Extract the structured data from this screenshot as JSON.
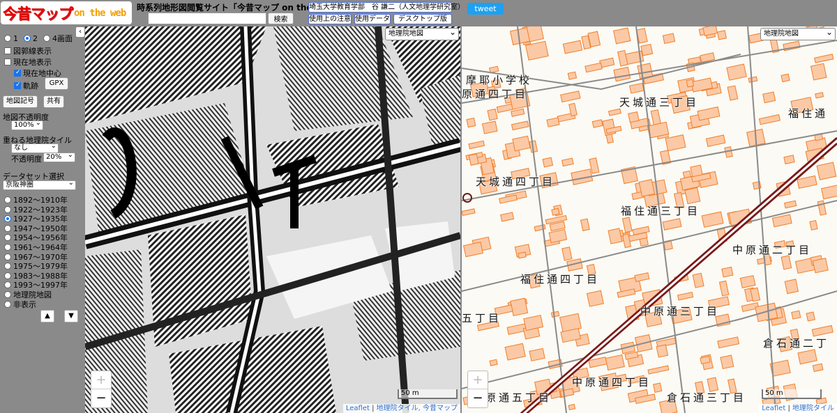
{
  "header": {
    "logo_main": "今昔マップ",
    "logo_sub": "on the web",
    "title": "時系列地形図閲覧サイト「今昔マップ on the web」",
    "search_placeholder": "",
    "search_button": "検索",
    "affiliation": "埼玉大学教育学部　谷 謙二（人文地理学研究室）",
    "notes_button": "使用上の注意",
    "data_button": "使用データ",
    "desktop_button": "デスクトップ版",
    "tweet_button": "tweet"
  },
  "sidebar": {
    "screen_options": [
      "1",
      "2",
      "4画面"
    ],
    "screen_selected": "2",
    "show_grid_label": "図郭線表示",
    "show_current_label": "現在地表示",
    "center_current_label": "現在地中心",
    "track_label": "軌跡",
    "gpx_button": "GPX",
    "legend_button": "地図記号",
    "share_button": "共有",
    "opacity_label": "地図不透明度",
    "opacity_value": "100%",
    "overlay_label": "重ねる地理院タイル",
    "overlay_value": "なし",
    "overlay_opacity_label": "不透明度",
    "overlay_opacity_value": "20%",
    "dataset_label": "データセット選択",
    "dataset_value": "京阪神圏",
    "periods": [
      "1892～1910年",
      "1922～1923年",
      "1927～1935年",
      "1947～1950年",
      "1954～1956年",
      "1961～1964年",
      "1967～1970年",
      "1975～1979年",
      "1983～1988年",
      "1993～1997年",
      "地理院地図",
      "非表示"
    ],
    "period_selected": "1927～1935年",
    "collapse_icon": "‹",
    "up_icon": "▲",
    "down_icon": "▼"
  },
  "left_map": {
    "layer_select": "地理院地図",
    "zoom_in": "+",
    "zoom_out": "−",
    "scale": "50 m",
    "attribution_leaflet": "Leaflet",
    "attribution_sep": " | ",
    "attribution_source": "地理院タイル, 今昔マップ"
  },
  "right_map": {
    "layer_select": "地理院地図",
    "zoom_in": "+",
    "zoom_out": "−",
    "scale": "50 m",
    "attribution_leaflet": "Leaflet",
    "attribution_sep": " | ",
    "attribution_source": "地理院タイル",
    "labels": {
      "school": "摩耶小学校",
      "l1": "原通四丁目",
      "l2": "天城通三丁目",
      "l3": "福住通",
      "l4": "天城通四丁目",
      "l5": "福住通三丁目",
      "l6": "中原通二丁目",
      "l7": "福住通四丁目",
      "l8": "中原通三丁目",
      "l9": "五丁目",
      "l10": "倉石通二丁",
      "l11": "中原通四丁目",
      "l12": "原通五丁目",
      "l13": "倉石通三丁目"
    }
  }
}
